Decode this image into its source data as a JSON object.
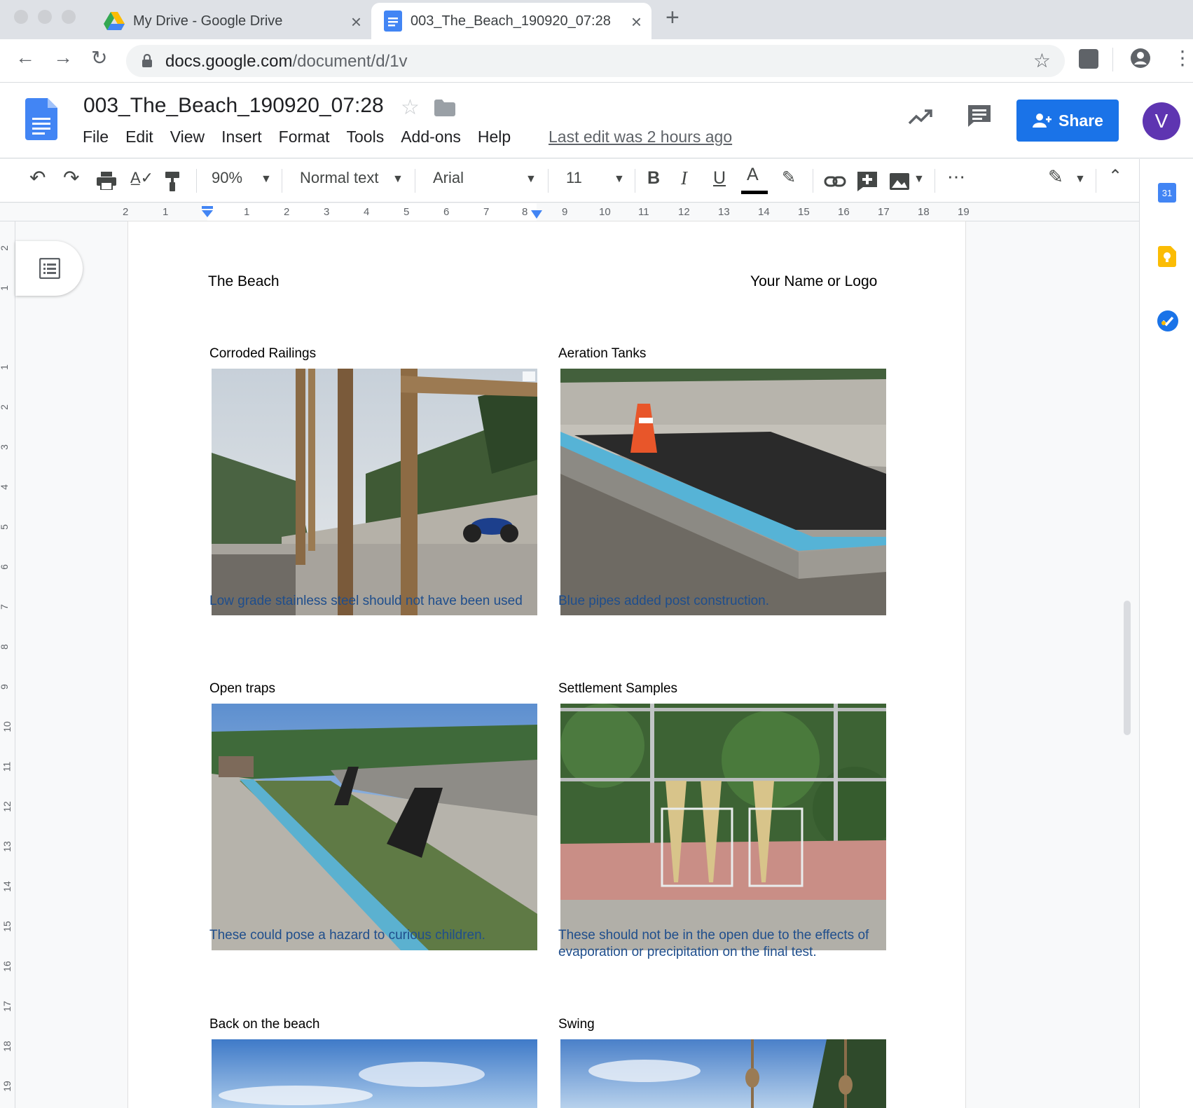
{
  "browser": {
    "tabs": [
      {
        "title": "My Drive - Google Drive",
        "icon": "google-drive-icon"
      },
      {
        "title": "003_The_Beach_190920_07:28",
        "icon": "google-docs-icon"
      }
    ],
    "url_host": "docs.google.com",
    "url_path": "/document/d/1v"
  },
  "doc": {
    "title": "003_The_Beach_190920_07:28",
    "menu": [
      "File",
      "Edit",
      "View",
      "Insert",
      "Format",
      "Tools",
      "Add-ons",
      "Help"
    ],
    "last_edit": "Last edit was 2 hours ago",
    "share_label": "Share",
    "avatar_initial": "V"
  },
  "toolbar": {
    "zoom": "90%",
    "style": "Normal text",
    "font": "Arial",
    "font_size": "11",
    "bold": "B",
    "italic": "I",
    "underline": "U",
    "text_color": "A",
    "more": "⋯"
  },
  "ruler": {
    "h_numbers": [
      "2",
      "1",
      "1",
      "2",
      "3",
      "4",
      "5",
      "6",
      "7",
      "8",
      "9",
      "10",
      "11",
      "12",
      "13",
      "14",
      "15",
      "16",
      "17",
      "18",
      "19"
    ],
    "v_numbers": [
      "2",
      "1",
      "1",
      "2",
      "3",
      "4",
      "5",
      "6",
      "7",
      "8",
      "9",
      "10",
      "11",
      "12",
      "13",
      "14",
      "15",
      "16",
      "17",
      "18",
      "19"
    ]
  },
  "page": {
    "header_left": "The Beach",
    "header_right": "Your Name or Logo",
    "cells": [
      {
        "title": "Corroded Railings",
        "caption": "Low grade stainless steel should not have been used"
      },
      {
        "title": "Aeration Tanks",
        "caption": "Blue pipes added post construction."
      },
      {
        "title": "Open traps",
        "caption": "These could pose a hazard to curious children."
      },
      {
        "title": "Settlement Samples",
        "caption": "These should not be in the open due to the effects of evaporation or precipitation on the final test."
      },
      {
        "title": "Back on the beach",
        "caption": ""
      },
      {
        "title": "Swing",
        "caption": ""
      }
    ]
  },
  "side_panel": {
    "calendar_day": "31",
    "apps": [
      "calendar-icon",
      "keep-icon",
      "tasks-icon"
    ]
  },
  "colors": {
    "accent": "#1a73e8",
    "caption": "#1f4e8c",
    "avatar": "#5e35b1"
  }
}
